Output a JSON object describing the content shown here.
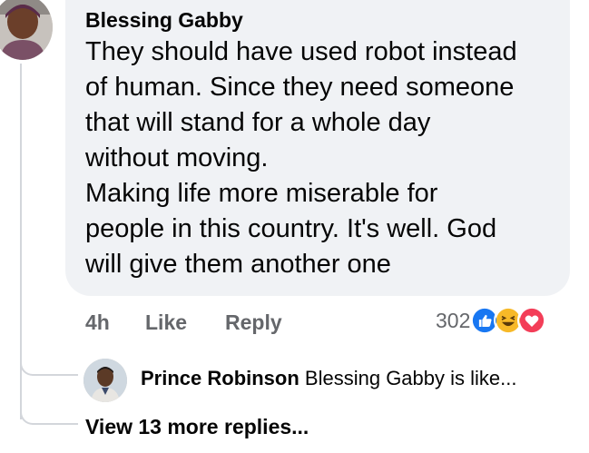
{
  "comment": {
    "author": "Blessing Gabby",
    "text": "They should have used robot instead\nof human. Since they need someone\nthat will stand for a whole day\nwithout moving.\nMaking life more miserable for\npeople in this country. It's well. God\nwill give them another one",
    "time": "4h",
    "like_label": "Like",
    "reply_label": "Reply",
    "reaction_count": "302",
    "reaction_icons": [
      "like-icon",
      "haha-icon",
      "love-icon"
    ]
  },
  "reply": {
    "author": "Prince Robinson",
    "preview": "Blessing Gabby is like..."
  },
  "more_replies_label": "View 13 more replies...",
  "colors": {
    "bubble": "#f0f2f5",
    "meta_text": "#65676b",
    "like_blue": "#1877f2",
    "haha_yellow": "#f7b928",
    "love_red": "#f33e58"
  }
}
